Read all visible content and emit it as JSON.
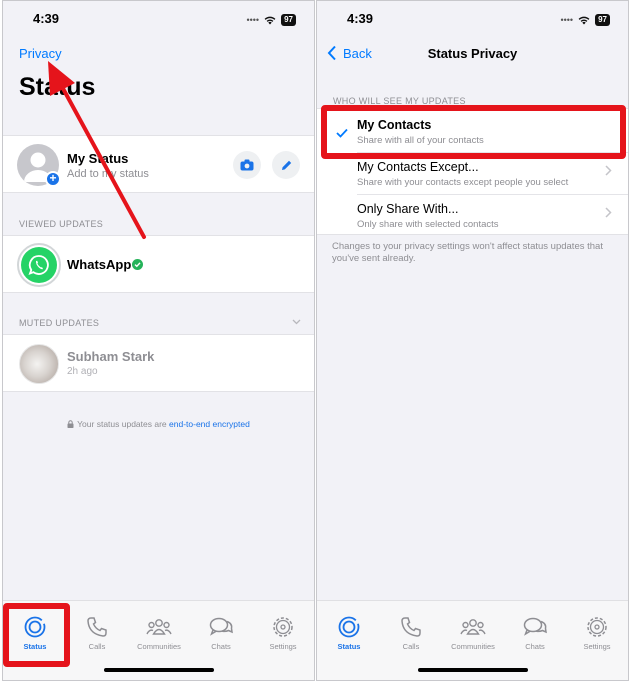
{
  "left": {
    "status_bar": {
      "time": "4:39",
      "battery": "97"
    },
    "nav": {
      "privacy_link": "Privacy"
    },
    "title": "Status",
    "my_status": {
      "name": "My Status",
      "subtitle": "Add to my status"
    },
    "viewed_updates": {
      "header": "VIEWED UPDATES",
      "items": [
        {
          "name": "WhatsApp"
        }
      ]
    },
    "muted_updates": {
      "header": "MUTED UPDATES",
      "items": [
        {
          "name": "Subham Stark",
          "time": "2h ago"
        }
      ]
    },
    "encryption_note": {
      "prefix": "Your status updates are ",
      "link": "end-to-end encrypted"
    },
    "tabs": [
      {
        "label": "Status",
        "icon": "status-icon",
        "active": true
      },
      {
        "label": "Calls",
        "icon": "phone-icon",
        "active": false
      },
      {
        "label": "Communities",
        "icon": "communities-icon",
        "active": false
      },
      {
        "label": "Chats",
        "icon": "chats-icon",
        "active": false
      },
      {
        "label": "Settings",
        "icon": "gear-icon",
        "active": false
      }
    ]
  },
  "right": {
    "status_bar": {
      "time": "4:39",
      "battery": "97"
    },
    "nav": {
      "back_label": "Back",
      "title": "Status Privacy"
    },
    "section_header": "WHO WILL SEE MY UPDATES",
    "options": [
      {
        "title": "My Contacts",
        "subtitle": "Share with all of your contacts",
        "selected": true
      },
      {
        "title": "My Contacts Except...",
        "subtitle": "Share with your contacts except people you select",
        "selected": false
      },
      {
        "title": "Only Share With...",
        "subtitle": "Only share with selected contacts",
        "selected": false
      }
    ],
    "footnote": "Changes to your privacy settings won't affect status updates that you've sent already.",
    "tabs": [
      {
        "label": "Status",
        "icon": "status-icon",
        "active": true
      },
      {
        "label": "Calls",
        "icon": "phone-icon",
        "active": false
      },
      {
        "label": "Communities",
        "icon": "communities-icon",
        "active": false
      },
      {
        "label": "Chats",
        "icon": "chats-icon",
        "active": false
      },
      {
        "label": "Settings",
        "icon": "gear-icon",
        "active": false
      }
    ]
  },
  "colors": {
    "accent": "#007aff",
    "highlight": "#e5141b",
    "whatsapp_green": "#25d366",
    "active_tab": "#1a73e8"
  }
}
